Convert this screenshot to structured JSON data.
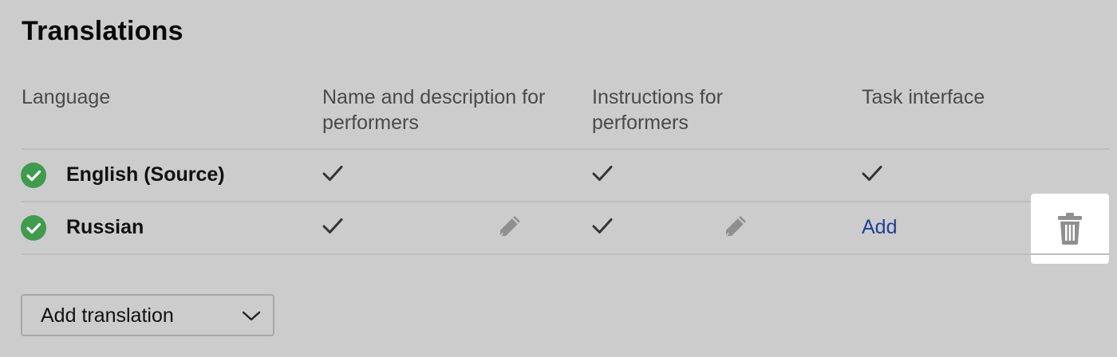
{
  "section": {
    "title": "Translations"
  },
  "table": {
    "headers": {
      "language": "Language",
      "name_description": "Name and description for performers",
      "instructions": "Instructions for performers",
      "task_interface": "Task interface"
    },
    "rows": [
      {
        "language": "English (Source)",
        "status": "complete",
        "name_description": "check",
        "instructions": "check",
        "task_interface": "check"
      },
      {
        "language": "Russian",
        "status": "complete",
        "name_description": "check",
        "instructions": "check",
        "task_interface_action": "Add"
      }
    ]
  },
  "add_translation": {
    "label": "Add translation"
  },
  "colors": {
    "status_ok": "#3f9b4d",
    "link": "#1f3f99",
    "background": "#cccccc"
  },
  "icons": {
    "status": "check-circle-icon",
    "check": "checkmark-icon",
    "edit": "pencil-icon",
    "delete": "trash-icon",
    "dropdown": "chevron-down-icon"
  }
}
